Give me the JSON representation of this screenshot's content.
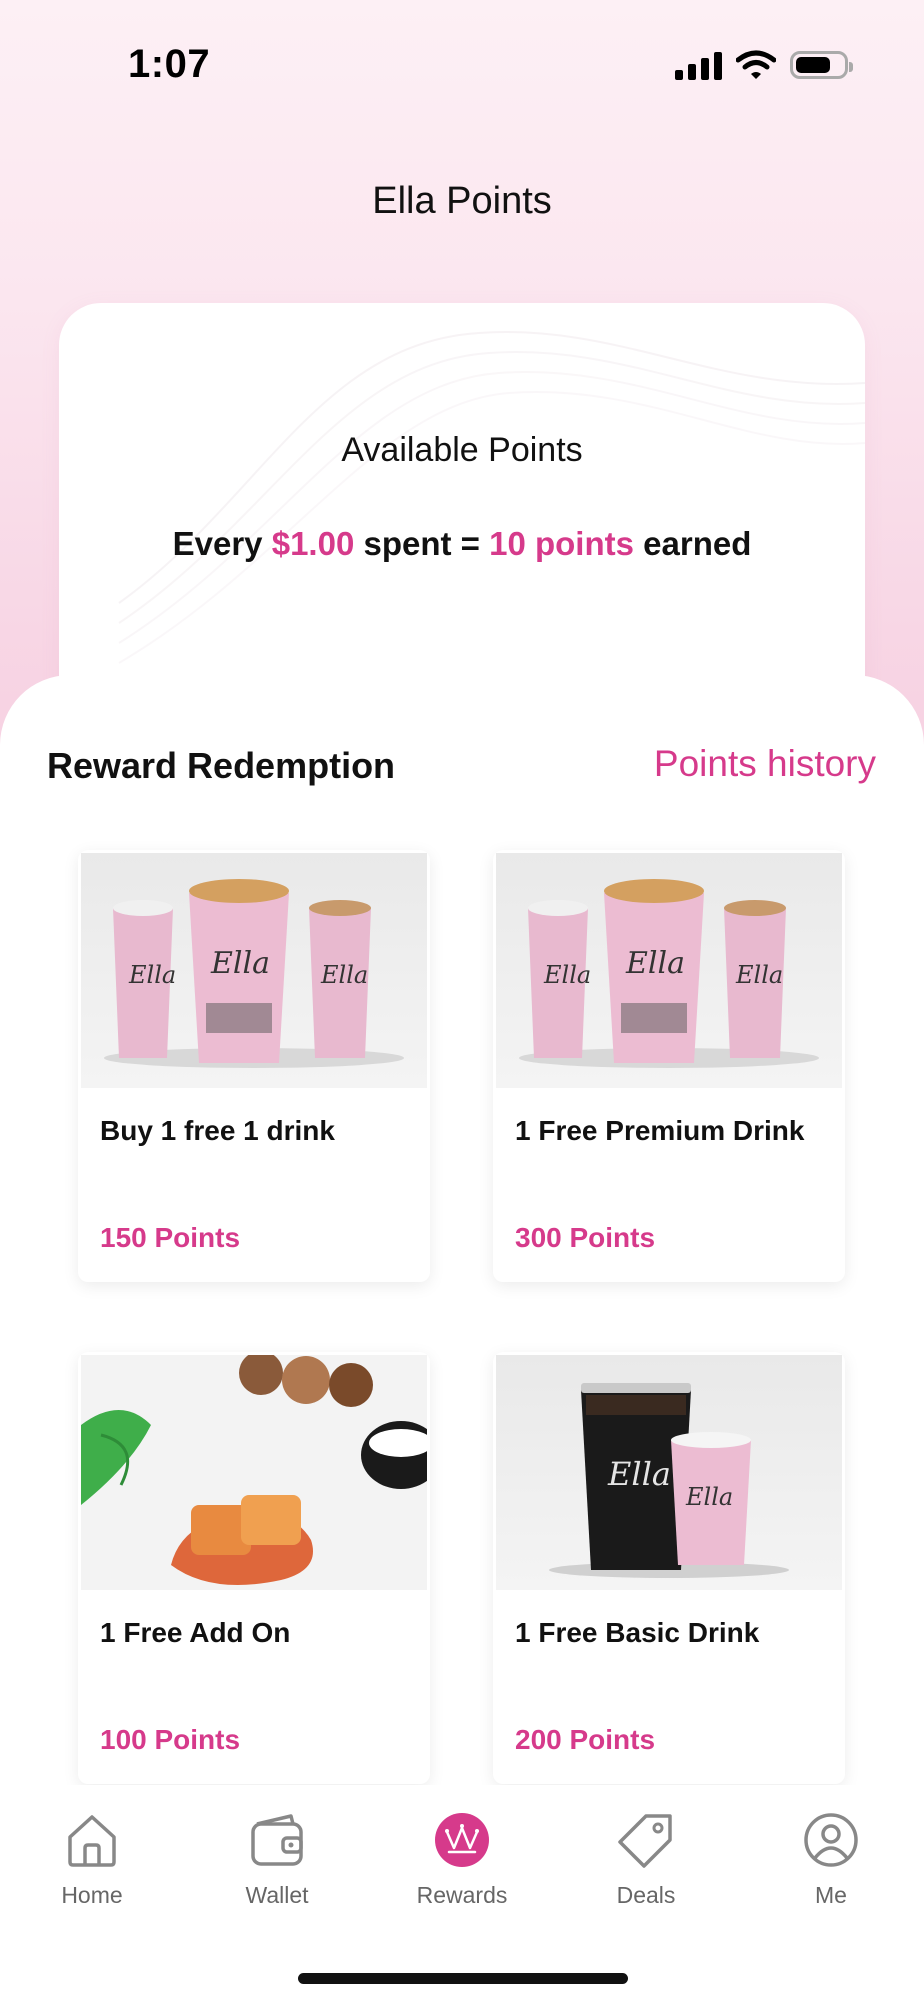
{
  "status": {
    "time": "1:07"
  },
  "header": {
    "title": "Ella Points"
  },
  "points_card": {
    "label": "Available Points",
    "earn_prefix": "Every",
    "earn_amount": "$1.00",
    "earn_mid": "spent =",
    "earn_points": "10 points",
    "earn_suffix": "earned"
  },
  "rewards": {
    "title": "Reward Redemption",
    "history_link": "Points history",
    "items": [
      {
        "name": "Buy 1 free 1 drink",
        "points": "150 Points",
        "image": "ella-cups-trio"
      },
      {
        "name": "1 Free Premium Drink",
        "points": "300 Points",
        "image": "ella-cups-trio"
      },
      {
        "name": "1 Free Add On",
        "points": "100 Points",
        "image": "caramel-mint-hazelnut"
      },
      {
        "name": "1 Free Basic Drink",
        "points": "200 Points",
        "image": "ella-cold-and-hot-cups"
      }
    ]
  },
  "tabbar": {
    "items": [
      {
        "label": "Home",
        "icon": "home-icon"
      },
      {
        "label": "Wallet",
        "icon": "wallet-icon"
      },
      {
        "label": "Rewards",
        "icon": "crown-icon",
        "active": true
      },
      {
        "label": "Deals",
        "icon": "tag-icon"
      },
      {
        "label": "Me",
        "icon": "profile-icon"
      }
    ]
  },
  "colors": {
    "accent": "#d63a8b",
    "background_top": "#fdf0f5",
    "background_bottom": "#f7d3e3"
  }
}
